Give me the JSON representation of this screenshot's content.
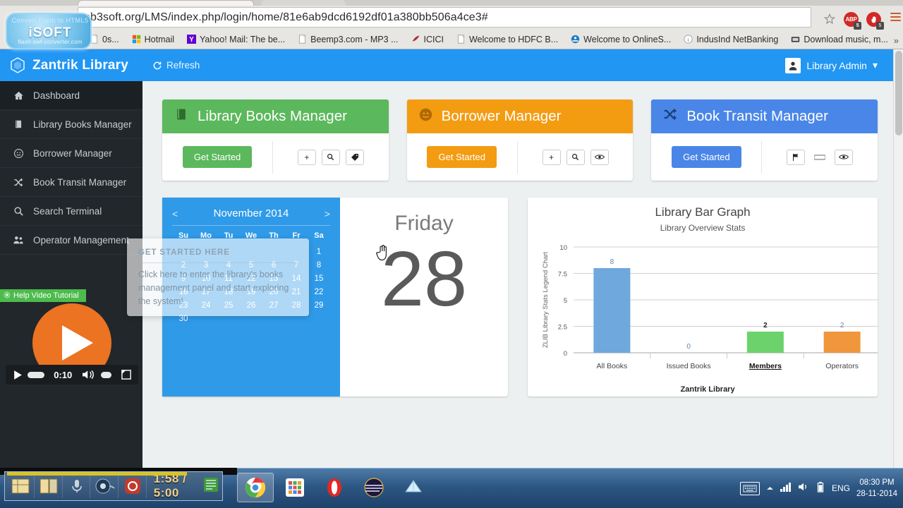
{
  "browser": {
    "url_visible": "eb3soft.org/LMS/index.php/login/home/81e6ab9dcd6192df01a380bb506a4ce3#",
    "url_host": "eb3soft.org",
    "url_path": "/LMS/index.php/login/home/81e6ab9dcd6192df01a380bb506a4ce3#",
    "overflow_label": "»",
    "abp_label": "ABP",
    "abp_badge": "5",
    "block_badge": "5",
    "bookmarks": [
      {
        "label": "0s...",
        "icon": "page-icon"
      },
      {
        "label": "Hotmail",
        "icon": "windows-icon"
      },
      {
        "label": "Yahoo! Mail: The be...",
        "icon": "yahoo-icon"
      },
      {
        "label": "Beemp3.com - MP3 ...",
        "icon": "page-icon"
      },
      {
        "label": "ICICI",
        "icon": "icici-icon"
      },
      {
        "label": "Welcome to HDFC B...",
        "icon": "page-icon"
      },
      {
        "label": "Welcome to OnlineS...",
        "icon": "sbi-icon"
      },
      {
        "label": "IndusInd NetBanking",
        "icon": "indusind-icon"
      },
      {
        "label": "Download music, m...",
        "icon": "download-icon"
      }
    ]
  },
  "watermark": {
    "top": "Convert Flash to HTML5",
    "main": "iSOFT",
    "sub": "flash-swf-converter.com"
  },
  "app": {
    "brand": "Zantrik Library",
    "refresh": "Refresh",
    "user": "Library Admin",
    "sidebar": [
      {
        "label": "Dashboard",
        "icon": "home-icon",
        "active": true
      },
      {
        "label": "Library Books Manager",
        "icon": "book-icon",
        "active": false
      },
      {
        "label": "Borrower Manager",
        "icon": "smiley-icon",
        "active": false
      },
      {
        "label": "Book Transit Manager",
        "icon": "shuffle-icon",
        "active": false
      },
      {
        "label": "Search Terminal",
        "icon": "search-icon",
        "active": false
      },
      {
        "label": "Operator Management",
        "icon": "users-icon",
        "active": false
      }
    ],
    "help_video": {
      "label": "Help Video Tutorial",
      "time": "0:10"
    },
    "cards": [
      {
        "title": "Library Books Manager",
        "icon": "book-icon",
        "color": "#5cb85c",
        "button": "Get Started",
        "actions": [
          "plus-icon",
          "search-icon",
          "tag-icon"
        ]
      },
      {
        "title": "Borrower Manager",
        "icon": "smiley-icon",
        "color": "#f39c12",
        "button": "Get Started",
        "actions": [
          "plus-icon",
          "search-icon",
          "eye-icon"
        ]
      },
      {
        "title": "Book Transit Manager",
        "icon": "shuffle-icon",
        "color": "#4a86e8",
        "button": "Get Started",
        "actions": [
          "flag-icon",
          "minus-icon",
          "eye-icon"
        ]
      }
    ],
    "popover": {
      "title": "GET STARTED HERE",
      "body": "Click here to enter the library's books management panel and start exploring the system!"
    },
    "calendar": {
      "month": "November 2014",
      "prev": "<",
      "next": ">",
      "dow": [
        "Su",
        "Mo",
        "Tu",
        "We",
        "Th",
        "Fr",
        "Sa"
      ],
      "lead_blanks": 6,
      "days": [
        1,
        2,
        3,
        4,
        5,
        6,
        7,
        8,
        9,
        10,
        11,
        12,
        13,
        14,
        15,
        16,
        17,
        18,
        19,
        20,
        21,
        22,
        23,
        24,
        25,
        26,
        27,
        28,
        29,
        30
      ]
    },
    "today": {
      "weekday": "Friday",
      "day": "28"
    }
  },
  "chart_data": {
    "type": "bar",
    "title": "Library Bar Graph",
    "subtitle": "Library Overview Stats",
    "xlabel": "Zantrik Library",
    "ylabel": "ZLIB Library Stats Legend Chart",
    "categories": [
      "All Books",
      "Issued Books",
      "Members",
      "Operators"
    ],
    "values": [
      8,
      0,
      2,
      2
    ],
    "value_labels": [
      "8",
      "0",
      "2",
      "2"
    ],
    "colors": [
      "#6fa8dc",
      "#6fa8dc",
      "#6cd36c",
      "#f0963c"
    ],
    "ylim": [
      0,
      10
    ],
    "yticks": [
      "0",
      "2.5",
      "5",
      "7.5",
      "10"
    ],
    "ytick_values": [
      0,
      2.5,
      5,
      7.5,
      10
    ],
    "grid": true,
    "legend": false,
    "highlighted_category": "Members"
  },
  "taskbar": {
    "apps": [
      "chrome-icon",
      "appgrid-icon",
      "opera-icon",
      "dark-circle-icon",
      "notepad-icon"
    ],
    "lang": "ENG",
    "time": "08:30 PM",
    "date": "28-11-2014",
    "tray_icons": [
      "keyboard-icon",
      "chevron-up-icon",
      "network-icon",
      "volume-icon",
      "battery-icon"
    ]
  },
  "recorder": {
    "time": "1:58 / 5:00"
  }
}
